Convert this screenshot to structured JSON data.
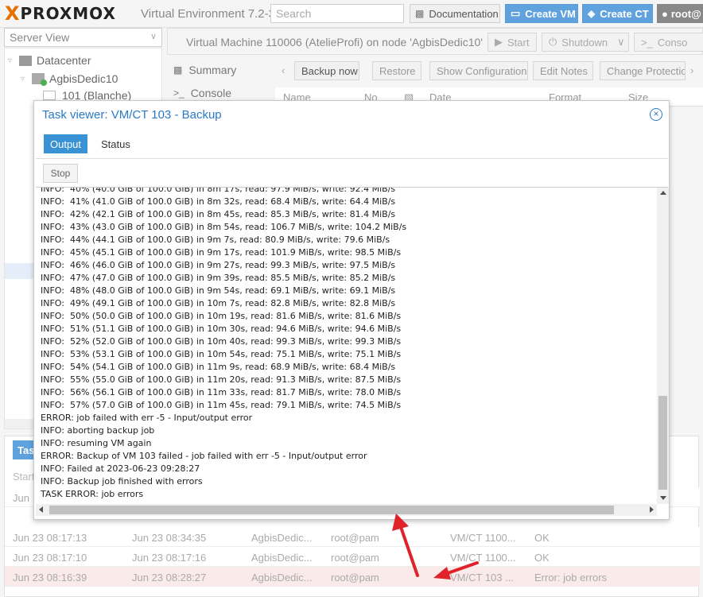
{
  "app": {
    "logo_x": "X",
    "logo_text": "PROXMOX",
    "version": "Virtual Environment 7.2-3"
  },
  "topbar": {
    "search_placeholder": "Search",
    "documentation": "Documentation",
    "create_vm": "Create VM",
    "create_ct": "Create CT",
    "user": "root@"
  },
  "sidebar": {
    "view_selector": "Server View",
    "datacenter": "Datacenter",
    "node": "AgbisDedic10",
    "vm_item": "101 (Blanche)"
  },
  "vm_panel": {
    "title": "Virtual Machine 110006 (AtelieProfi) on node 'AgbisDedic10'",
    "start": "Start",
    "shutdown": "Shutdown",
    "console": "Conso",
    "nav": [
      "Summary",
      "Console"
    ],
    "toolbar": [
      "Backup now",
      "Restore",
      "Show Configuration",
      "Edit Notes",
      "Change Protectio"
    ],
    "columns": [
      "Name",
      "No",
      "Date",
      "Format",
      "Size"
    ]
  },
  "modal": {
    "title": "Task viewer: VM/CT 103 - Backup",
    "tabs": [
      "Output",
      "Status"
    ],
    "stop": "Stop",
    "log_lines": [
      "INFO:  40% (40.0 GiB of 100.0 GiB) in 8m 17s, read: 97.9 MiB/s, write: 92.4 MiB/s",
      "INFO:  41% (41.0 GiB of 100.0 GiB) in 8m 32s, read: 68.4 MiB/s, write: 64.4 MiB/s",
      "INFO:  42% (42.1 GiB of 100.0 GiB) in 8m 45s, read: 85.3 MiB/s, write: 81.4 MiB/s",
      "INFO:  43% (43.0 GiB of 100.0 GiB) in 8m 54s, read: 106.7 MiB/s, write: 104.2 MiB/s",
      "INFO:  44% (44.1 GiB of 100.0 GiB) in 9m 7s, read: 80.9 MiB/s, write: 79.6 MiB/s",
      "INFO:  45% (45.1 GiB of 100.0 GiB) in 9m 17s, read: 101.9 MiB/s, write: 98.5 MiB/s",
      "INFO:  46% (46.0 GiB of 100.0 GiB) in 9m 27s, read: 99.3 MiB/s, write: 97.5 MiB/s",
      "INFO:  47% (47.0 GiB of 100.0 GiB) in 9m 39s, read: 85.5 MiB/s, write: 85.2 MiB/s",
      "INFO:  48% (48.0 GiB of 100.0 GiB) in 9m 54s, read: 69.1 MiB/s, write: 69.1 MiB/s",
      "INFO:  49% (49.1 GiB of 100.0 GiB) in 10m 7s, read: 82.8 MiB/s, write: 82.8 MiB/s",
      "INFO:  50% (50.0 GiB of 100.0 GiB) in 10m 19s, read: 81.6 MiB/s, write: 81.6 MiB/s",
      "INFO:  51% (51.1 GiB of 100.0 GiB) in 10m 30s, read: 94.6 MiB/s, write: 94.6 MiB/s",
      "INFO:  52% (52.0 GiB of 100.0 GiB) in 10m 40s, read: 99.3 MiB/s, write: 99.3 MiB/s",
      "INFO:  53% (53.1 GiB of 100.0 GiB) in 10m 54s, read: 75.1 MiB/s, write: 75.1 MiB/s",
      "INFO:  54% (54.1 GiB of 100.0 GiB) in 11m 9s, read: 68.9 MiB/s, write: 68.4 MiB/s",
      "INFO:  55% (55.0 GiB of 100.0 GiB) in 11m 20s, read: 91.3 MiB/s, write: 87.5 MiB/s",
      "INFO:  56% (56.1 GiB of 100.0 GiB) in 11m 33s, read: 81.7 MiB/s, write: 78.0 MiB/s",
      "INFO:  57% (57.0 GiB of 100.0 GiB) in 11m 45s, read: 79.1 MiB/s, write: 74.5 MiB/s",
      "ERROR: job failed with err -5 - Input/output error",
      "INFO: aborting backup job",
      "INFO: resuming VM again",
      "ERROR: Backup of VM 103 failed - job failed with err -5 - Input/output error",
      "INFO: Failed at 2023-06-23 09:28:27",
      "INFO: Backup job finished with errors",
      "TASK ERROR: job errors"
    ]
  },
  "tasklog": {
    "tab": "Tasks",
    "header": "Start",
    "rows": [
      {
        "start": "Jun 23 08:17:13",
        "end": "Jun 23 08:34:35",
        "node": "AgbisDedic...",
        "user": "root@pam",
        "desc": "VM/CT 1100...",
        "status": "OK",
        "error": false
      },
      {
        "start": "Jun 23 08:17:10",
        "end": "Jun 23 08:17:16",
        "node": "AgbisDedic...",
        "user": "root@pam",
        "desc": "VM/CT 1100...",
        "status": "OK",
        "error": false
      },
      {
        "start": "Jun 23 08:16:39",
        "end": "Jun 23 08:28:27",
        "node": "AgbisDedic...",
        "user": "root@pam",
        "desc": "VM/CT 103 ...",
        "status": "Error: job errors",
        "error": true
      }
    ],
    "partial_row_start": "Jun"
  },
  "colors": {
    "accent": "#5fa2dd",
    "title_blue": "#2a7ac7",
    "brand_orange": "#e57000",
    "annotation_red": "#e0232b"
  }
}
